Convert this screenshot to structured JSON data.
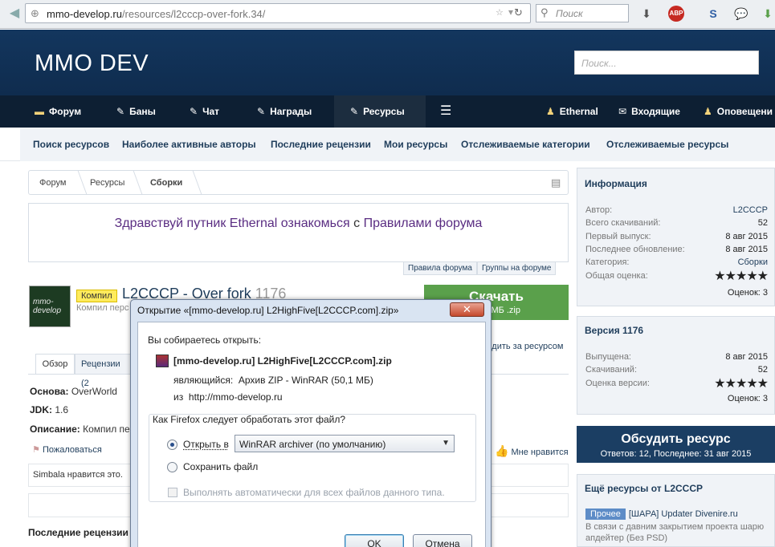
{
  "browser": {
    "url_host": "mmo-develop.ru",
    "url_path": "/resources/l2cccp-over-fork.34/",
    "search_placeholder": "Поиск"
  },
  "header": {
    "logo": "MMO DEV",
    "search_placeholder": "Поиск..."
  },
  "nav": {
    "items": [
      {
        "label": "Форум"
      },
      {
        "label": "Баны"
      },
      {
        "label": "Чат"
      },
      {
        "label": "Награды"
      },
      {
        "label": "Ресурсы"
      }
    ],
    "user": "Ethernal",
    "inbox": "Входящие",
    "alerts": "Оповещени"
  },
  "subnav": [
    "Поиск ресурсов",
    "Наиболее активные авторы",
    "Последние рецензии",
    "Мои ресурсы",
    "Отслеживаемые категории",
    "Отслеживаемые ресурсы"
  ],
  "breadcrumbs": [
    "Форум",
    "Ресурсы",
    "Сборки"
  ],
  "notice": {
    "part1": "Здравствуй путник Ethernal ознакомься",
    "part2": " с ",
    "part3": "Правилами форума"
  },
  "notice_tabs": [
    "Правила форума",
    "Группы на форуме"
  ],
  "resource": {
    "badge": "Компил",
    "title": "L2CCCP - Over fork",
    "version": "1176",
    "subtitle": "Компил перс",
    "logo_text": "mmo-develop",
    "download_label": "Скачать",
    "download_sub": "МБ .zip",
    "follow": "ледить за ресурсом",
    "tabs": [
      "Обзор",
      "Рецензии (2"
    ],
    "fields": [
      {
        "key": "Основа:",
        "value": " OverWorld"
      },
      {
        "key": "JDK:",
        "value": " 1.6"
      },
      {
        "key": "Описание:",
        "value": " Компил пе"
      }
    ],
    "complain": "Пожаловаться",
    "like": "Мне нравится",
    "likes_text": "Simbala нравится это.",
    "last_reviews": "Последние рецензии"
  },
  "sidebar": {
    "info_title": "Информация",
    "info_rows": [
      {
        "k": "Автор:",
        "v": "L2CCCP"
      },
      {
        "k": "Всего скачиваний:",
        "v": "52"
      },
      {
        "k": "Первый выпуск:",
        "v": "8 авг 2015"
      },
      {
        "k": "Последнее обновление:",
        "v": "8 авг 2015"
      },
      {
        "k": "Категория:",
        "v": "Сборки"
      },
      {
        "k": "Общая оценка:",
        "v": "★★★★★"
      }
    ],
    "info_votes": "Оценок: 3",
    "version_title": "Версия 1176",
    "version_rows": [
      {
        "k": "Выпущена:",
        "v": "8 авг 2015"
      },
      {
        "k": "Скачиваний:",
        "v": "52"
      },
      {
        "k": "Оценка версии:",
        "v": "★★★★★"
      }
    ],
    "version_votes": "Оценок: 3",
    "discuss_title": "Обсудить ресурс",
    "discuss_sub": "Ответов: 12, Последнее: 31 авг 2015",
    "more_title": "Ещё ресурсы от L2CCCP",
    "more_tag": "Прочее",
    "more_item": "[ШАРА] Updater Divenire.ru",
    "more_desc": "В связи с давним закрытием проекта шарю апдейтер (Без PSD)"
  },
  "dialog": {
    "title": "Открытие «[mmo-develop.ru] L2HighFive[L2CCCP.com].zip»",
    "intro": "Вы собираетесь открыть:",
    "filename": "[mmo-develop.ru] L2HighFive[L2CCCP.com].zip",
    "type_label": "являющийся:",
    "type_value": "Архив ZIP - WinRAR (50,1 МБ)",
    "from_label": "из",
    "from_value": "http://mmo-develop.ru",
    "question": "Как Firefox следует обработать этот файл?",
    "open_with": "Открыть в",
    "open_app": "WinRAR archiver (по умолчанию)",
    "save": "Сохранить файл",
    "auto": "Выполнять автоматически для всех файлов данного типа.",
    "ok": "OK",
    "cancel": "Отмена"
  }
}
